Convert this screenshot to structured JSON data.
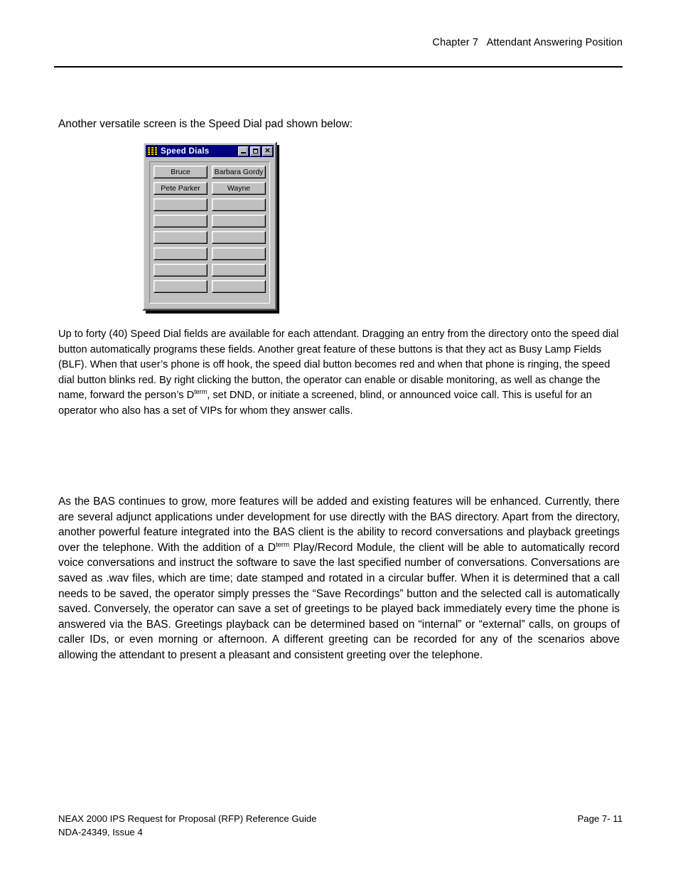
{
  "header": {
    "chapter": "Chapter 7   Attendant Answering Position"
  },
  "intro": {
    "text": "Another versatile screen is the Speed Dial pad shown below:"
  },
  "dialog": {
    "title": "Speed Dials",
    "icon": "keypad-icon",
    "titlebar_color": "#000080",
    "face_color": "#c0c0c0",
    "minimize_label": "_",
    "maximize_label": "□",
    "close_label": "✕",
    "buttons": [
      {
        "label": "Bruce"
      },
      {
        "label": "Barbara Gordy"
      },
      {
        "label": "Pete Parker"
      },
      {
        "label": "Wayne"
      },
      {
        "label": ""
      },
      {
        "label": ""
      },
      {
        "label": ""
      },
      {
        "label": ""
      },
      {
        "label": ""
      },
      {
        "label": ""
      },
      {
        "label": ""
      },
      {
        "label": ""
      },
      {
        "label": ""
      },
      {
        "label": ""
      },
      {
        "label": ""
      },
      {
        "label": ""
      }
    ]
  },
  "paragraphs": {
    "blf_part1": "Up to forty (40) Speed Dial fields are available for each attendant.  Dragging an entry from the directory onto the speed dial button automatically programs these fields.  Another great feature of these buttons is that they act as Busy Lamp Fields (BLF).  When that user’s phone is off hook, the speed dial button becomes red and when that phone is ringing, the speed dial button blinks red.  By right clicking the button, the operator can enable or disable monitoring, as well as change the name, forward the person’s D",
    "blf_sup": "term",
    "blf_part2": ", set DND, or initiate a screened, blind, or announced voice call.  This is useful for an operator who also has a set of VIPs for whom they answer calls.",
    "bas_part1": "As the BAS continues to grow, more features will be added and existing features will be enhanced.  Currently, there are several adjunct applications under development for use directly with the BAS directory. Apart from the directory, another powerful feature integrated into the BAS client is the ability to record conversations and playback greetings over the telephone. With the addition of a D",
    "bas_sup": "term",
    "bas_part2": " Play/Record Module, the client will be able to automatically record voice conversations and instruct the software to save the last specified number of conversations.   Conversations are saved as .wav files, which are time; date stamped and rotated in a circular buffer. When it is determined that a call needs to be saved, the operator simply presses the “Save Recordings” button and the selected call is automatically saved.  Conversely, the operator can save a set of greetings to be played back immediately every time the phone is answered via the BAS.  Greetings playback can be determined based on “internal” or “external” calls, on groups of caller IDs, or even morning or afternoon.  A different greeting can be recorded for any of the scenarios above allowing the attendant to present a pleasant and consistent greeting over the telephone."
  },
  "footer": {
    "line1_left": "NEAX 2000 IPS Request for Proposal (RFP) Reference Guide",
    "line1_right": "Page 7- 11",
    "line2_left": "NDA-24349, Issue 4"
  }
}
